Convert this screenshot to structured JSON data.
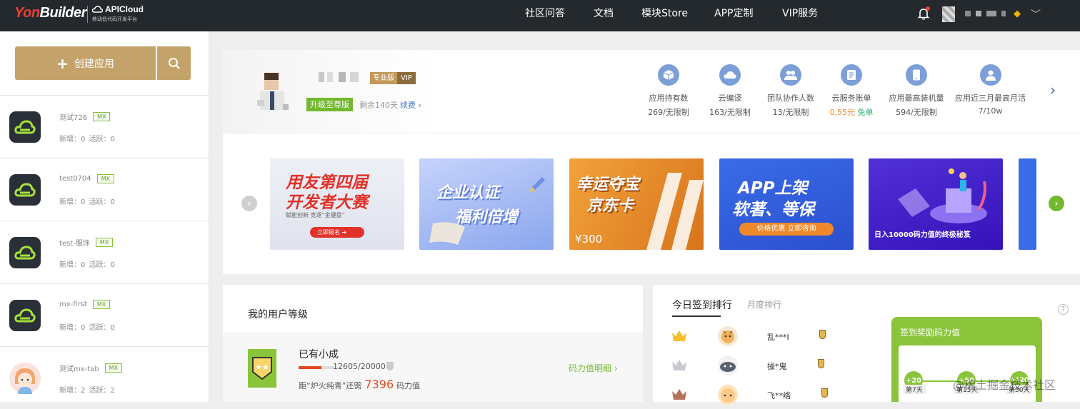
{
  "header": {
    "logo_yon": "Yon",
    "logo_builder": "Builder",
    "apicloud": "APICloud",
    "apicloud_sub": "移动低代码开发平台",
    "nav": [
      "社区问答",
      "文档",
      "模块Store",
      "APP定制",
      "VIP服务"
    ],
    "accent": "#e94134"
  },
  "sidebar": {
    "create_label": "创建应用",
    "apps": [
      {
        "name": "测试726",
        "tag": "MX",
        "stats": "新增：0   活跃：0"
      },
      {
        "name": "test0704",
        "tag": "MX",
        "stats": "新增：0   活跃：0"
      },
      {
        "name": "test-服饰",
        "tag": "MX",
        "stats": "新增：0   活跃：0"
      },
      {
        "name": "mx-first",
        "tag": "MX",
        "stats": "新增：0   活跃：0"
      },
      {
        "name": "测试mx-tab",
        "tag": "MX",
        "stats": "新增：2   活跃：2"
      }
    ]
  },
  "profile": {
    "edition": "专业版",
    "vip": "VIP",
    "upgrade": "升级至尊版",
    "remaining": "剩余140天",
    "renew": "续费 ›",
    "stats": [
      {
        "label": "应用持有数",
        "value": "269/无限制",
        "icon": "cube-icon"
      },
      {
        "label": "云编译",
        "value": "163/无限制",
        "icon": "cloud-icon"
      },
      {
        "label": "团队协作人数",
        "value": "13/无限制",
        "icon": "team-icon"
      },
      {
        "label": "云服务账单",
        "value": "0.55元",
        "value2": "免单",
        "icon": "bill-icon"
      },
      {
        "label": "应用最高装机量",
        "value": "594/无限制",
        "icon": "phone-icon"
      },
      {
        "label": "应用近三月最高月活",
        "value": "7/10w",
        "icon": "user-icon"
      }
    ]
  },
  "banners": {
    "b1_line1": "用友第四届",
    "b1_line2": "开发者大赛",
    "b1_sub": "赋能创新  竞逐“金键盘”",
    "b1_btn": "立即报名",
    "b2_line1": "企业认证",
    "b2_line2": "福利倍增",
    "b3_line1": "幸运夺宝",
    "b3_line2": "京东卡",
    "b3_price": "¥300",
    "b4_line1": "APP上架",
    "b4_line2": "软著、等保",
    "b4_btn": "价格优惠 立即咨询",
    "b5_text": "日入10000码力值的终极秘笈"
  },
  "level": {
    "title": "我的用户等级",
    "name": "已有小成",
    "points": "12605/20000",
    "need_prefix": "距“炉火纯青”还需",
    "need_value": "7396",
    "need_unit": "码力值",
    "detail": "码力值明细 ›",
    "progress": 0.63
  },
  "checkin": {
    "tab_today": "今日签到排行",
    "tab_month": "月度排行",
    "help": "?",
    "ranks": [
      {
        "name": "乱***I"
      },
      {
        "name": "操*鬼"
      },
      {
        "name": "飞**络"
      }
    ],
    "reward_title": "签到奖励码力值",
    "days": [
      {
        "bonus": "+20",
        "label": "第7天"
      },
      {
        "bonus": "+50",
        "label": "第15天"
      },
      {
        "bonus": "+120",
        "label": "第30天"
      }
    ]
  },
  "watermark": "@稀土掘金技术社区"
}
